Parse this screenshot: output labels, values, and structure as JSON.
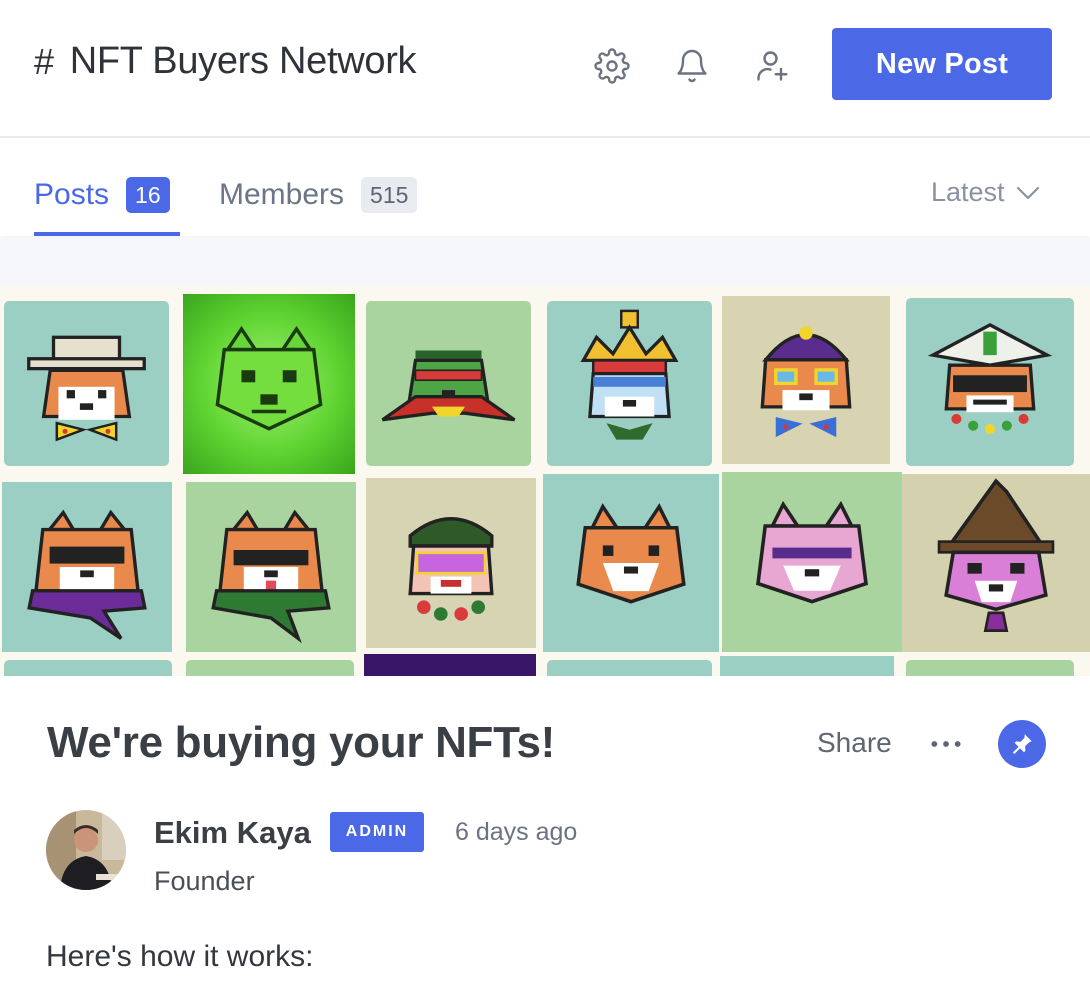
{
  "header": {
    "hash": "#",
    "title": "NFT Buyers Network",
    "new_post_label": "New Post",
    "icons": [
      "gear-icon",
      "bell-icon",
      "add-user-icon"
    ]
  },
  "tabs": {
    "posts_label": "Posts",
    "posts_count": "16",
    "members_label": "Members",
    "members_count": "515",
    "sort_label": "Latest"
  },
  "post": {
    "title": "We're buying your NFTs!",
    "share_label": "Share",
    "more_icon": "more-horizontal-icon",
    "pin_icon": "pin-icon",
    "author": {
      "name": "Ekim Kaya",
      "role_badge": "ADMIN",
      "title": "Founder",
      "posted": "6 days ago"
    },
    "body": "Here's how it works:"
  },
  "colors": {
    "accent": "#4b68e6",
    "tile_teal": "#9ccfc4",
    "tile_green": "#a9d49f",
    "tile_khaki": "#cfd0ae",
    "tile_bright_green": "#5fd431"
  }
}
